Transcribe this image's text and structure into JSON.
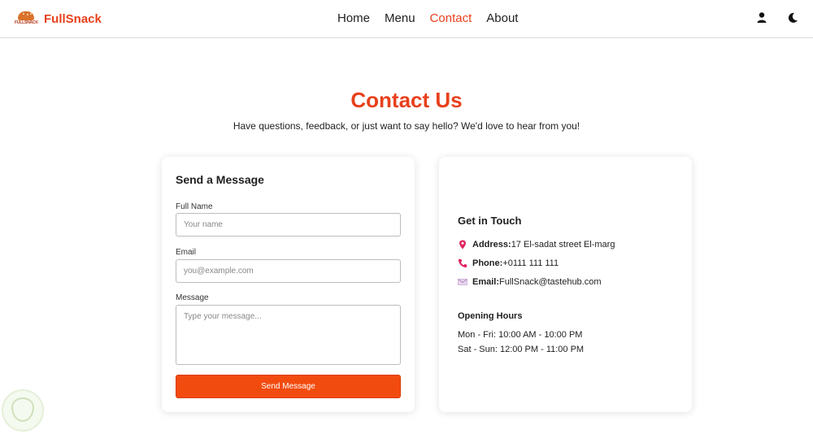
{
  "brand": {
    "logo_text": "FULLSNACK",
    "name": "FullSnack",
    "color": "#e8401c"
  },
  "nav": {
    "items": [
      {
        "label": "Home",
        "active": false
      },
      {
        "label": "Menu",
        "active": false
      },
      {
        "label": "Contact",
        "active": true
      },
      {
        "label": "About",
        "active": false
      }
    ],
    "icons": [
      "user-icon",
      "moon-icon"
    ]
  },
  "header": {
    "title": "Contact Us",
    "subtitle": "Have questions, feedback, or just want to say hello? We'd love to hear from you!"
  },
  "form": {
    "title": "Send a Message",
    "name_label": "Full Name",
    "name_placeholder": "Your name",
    "email_label": "Email",
    "email_placeholder": "you@example.com",
    "message_label": "Message",
    "message_placeholder": "Type your message...",
    "submit_label": "Send Message",
    "button_color": "#f24b0f"
  },
  "info": {
    "title": "Get in Touch",
    "address_label": "Address:",
    "address_value": "17 El-sadat street El-marg",
    "phone_label": "Phone:",
    "phone_value": "+0111 111 111",
    "email_label": "Email:",
    "email_value": "FullSnack@tastehub.com",
    "icons": [
      "pin-icon",
      "phone-icon",
      "envelope-icon"
    ],
    "hours_title": "Opening Hours",
    "hours": [
      "Mon - Fri: 10:00 AM - 10:00 PM",
      "Sat - Sun: 12:00 PM - 11:00 PM"
    ]
  }
}
